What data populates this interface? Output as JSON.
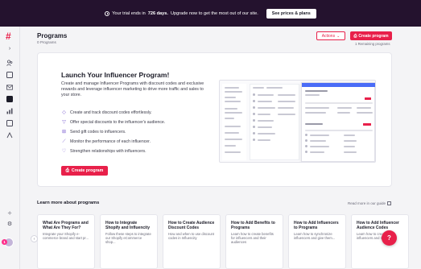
{
  "banner": {
    "text_prefix": "Your trial ends in",
    "days": "726 days.",
    "text_suffix": "Upgrade now to get the most out of our site.",
    "button_label": "See prices & plans"
  },
  "sidebar": {
    "logo": "#",
    "icons": [
      "chevron-right-icon",
      "users-icon",
      "contacts-icon",
      "mail-icon",
      "programs-icon",
      "chart-icon",
      "content-icon",
      "integrations-icon",
      "sparkle-icon",
      "settings-icon"
    ]
  },
  "header": {
    "title": "Programs",
    "subtitle": "0 Programs",
    "actions_label": "Actions",
    "create_label": "Create program",
    "remaining": "1 Remaining programs"
  },
  "hero": {
    "title": "Launch Your Influencer Program!",
    "description": "Create and manage Influencer Programs with discount codes and exclusive rewards and leverage influencer marketing to drive more traffic and sales to your store.",
    "features": [
      {
        "icon": "tag-icon",
        "text": "Create and track discount codes effortlessly."
      },
      {
        "icon": "filter-icon",
        "text": "Offer special discounts to the influencer's audience."
      },
      {
        "icon": "gift-icon",
        "text": "Send gift codes to influencers."
      },
      {
        "icon": "trend-icon",
        "text": "Monitor the performance of each influencer."
      },
      {
        "icon": "heart-icon",
        "text": "Strengthen relationships with influencers."
      }
    ],
    "button_label": "Create program"
  },
  "learn": {
    "title": "Learn more about programs",
    "read_more": "Read more in our guide",
    "guides": [
      {
        "title": "What Are Programs and What Are They For?",
        "desc": "Integrate your Shopify e-commerce brand and start pr..."
      },
      {
        "title": "How to Integrate Shopify and Influencity",
        "desc": "Follow these steps to integrate our Shopify eCommerce shop..."
      },
      {
        "title": "How to Create Audience Discount Codes",
        "desc": "How and when to use discount codes in Influencity"
      },
      {
        "title": "How to Add Benefits to Programs",
        "desc": "Learn how to create benefits for influencers and their audiences"
      },
      {
        "title": "How to Add Influencers to Programs",
        "desc": "Learn how to synchronize influencers and give them..."
      },
      {
        "title": "How to Add Influencer Audience Codes",
        "desc": "Learn how to create influencers and their..."
      }
    ]
  },
  "colors": {
    "accent": "#e8204a",
    "banner_bg": "#24122e",
    "feature_icon": "#7a5cd0"
  }
}
